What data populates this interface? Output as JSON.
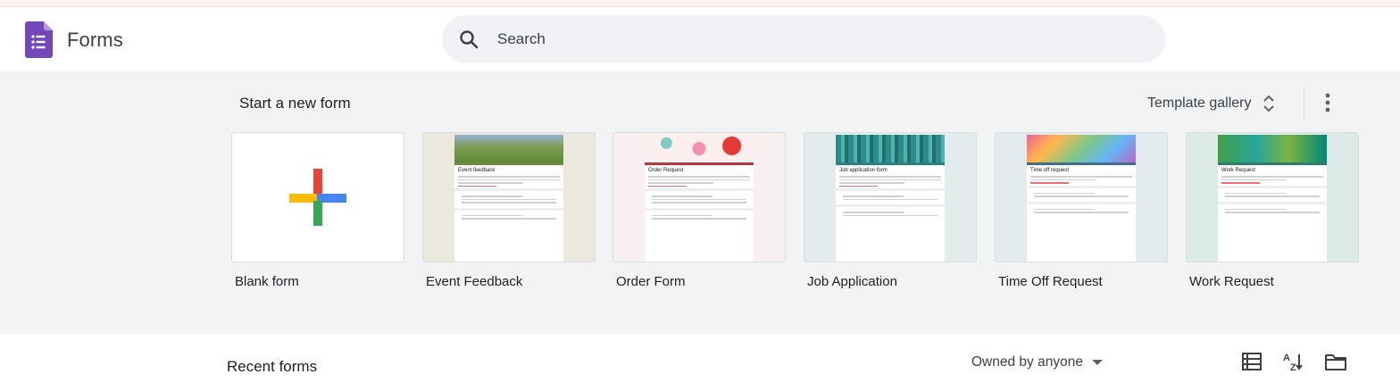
{
  "app": {
    "title": "Forms"
  },
  "search": {
    "placeholder": "Search"
  },
  "gallery": {
    "heading": "Start a new form",
    "template_gallery_label": "Template gallery",
    "templates": [
      {
        "label": "Blank form",
        "thumb_title": ""
      },
      {
        "label": "Event Feedback",
        "thumb_title": "Event feedback"
      },
      {
        "label": "Order Form",
        "thumb_title": "Order Request"
      },
      {
        "label": "Job Application",
        "thumb_title": "Job application form"
      },
      {
        "label": "Time Off Request",
        "thumb_title": "Time off request"
      },
      {
        "label": "Work Request",
        "thumb_title": "Work Request"
      }
    ]
  },
  "recent": {
    "heading": "Recent forms",
    "owner_filter": "Owned by anyone"
  },
  "icons": {
    "logo": "forms-logo-icon",
    "search": "search-icon",
    "sort_toggle": "unfold-icon",
    "more": "more-vert-icon",
    "list_view": "list-view-icon",
    "sort_az": "sort-az-icon",
    "folder": "folder-icon"
  },
  "colors": {
    "brand_purple": "#7248b9",
    "google_red": "#ea4335",
    "google_blue": "#4285f4",
    "google_yellow": "#fbbc04",
    "google_green": "#34a853",
    "gallery_bg": "#f1f3f4"
  }
}
